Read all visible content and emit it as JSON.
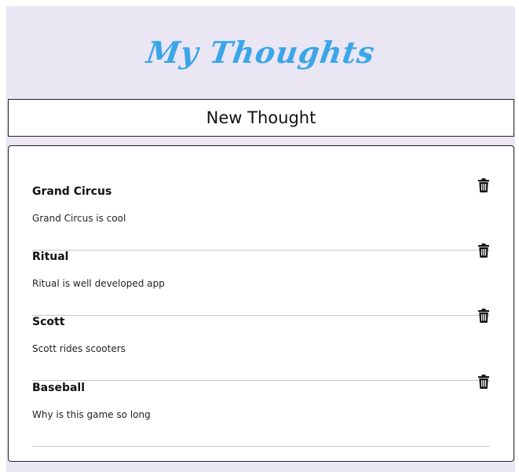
{
  "app": {
    "title": "My Thoughts",
    "accent_color": "#3aa6e8",
    "background_color": "#ebe6f4"
  },
  "toolbar": {
    "new_thought_label": "New Thought"
  },
  "thoughts": [
    {
      "title": "Grand Circus",
      "body": "Grand Circus is cool",
      "icon": "trash-icon"
    },
    {
      "title": "Ritual",
      "body": "Ritual is well developed app",
      "icon": "trash-icon"
    },
    {
      "title": "Scott",
      "body": "Scott rides scooters",
      "icon": "trash-icon"
    },
    {
      "title": "Baseball",
      "body": "Why is this game so long",
      "icon": "trash-icon"
    }
  ]
}
